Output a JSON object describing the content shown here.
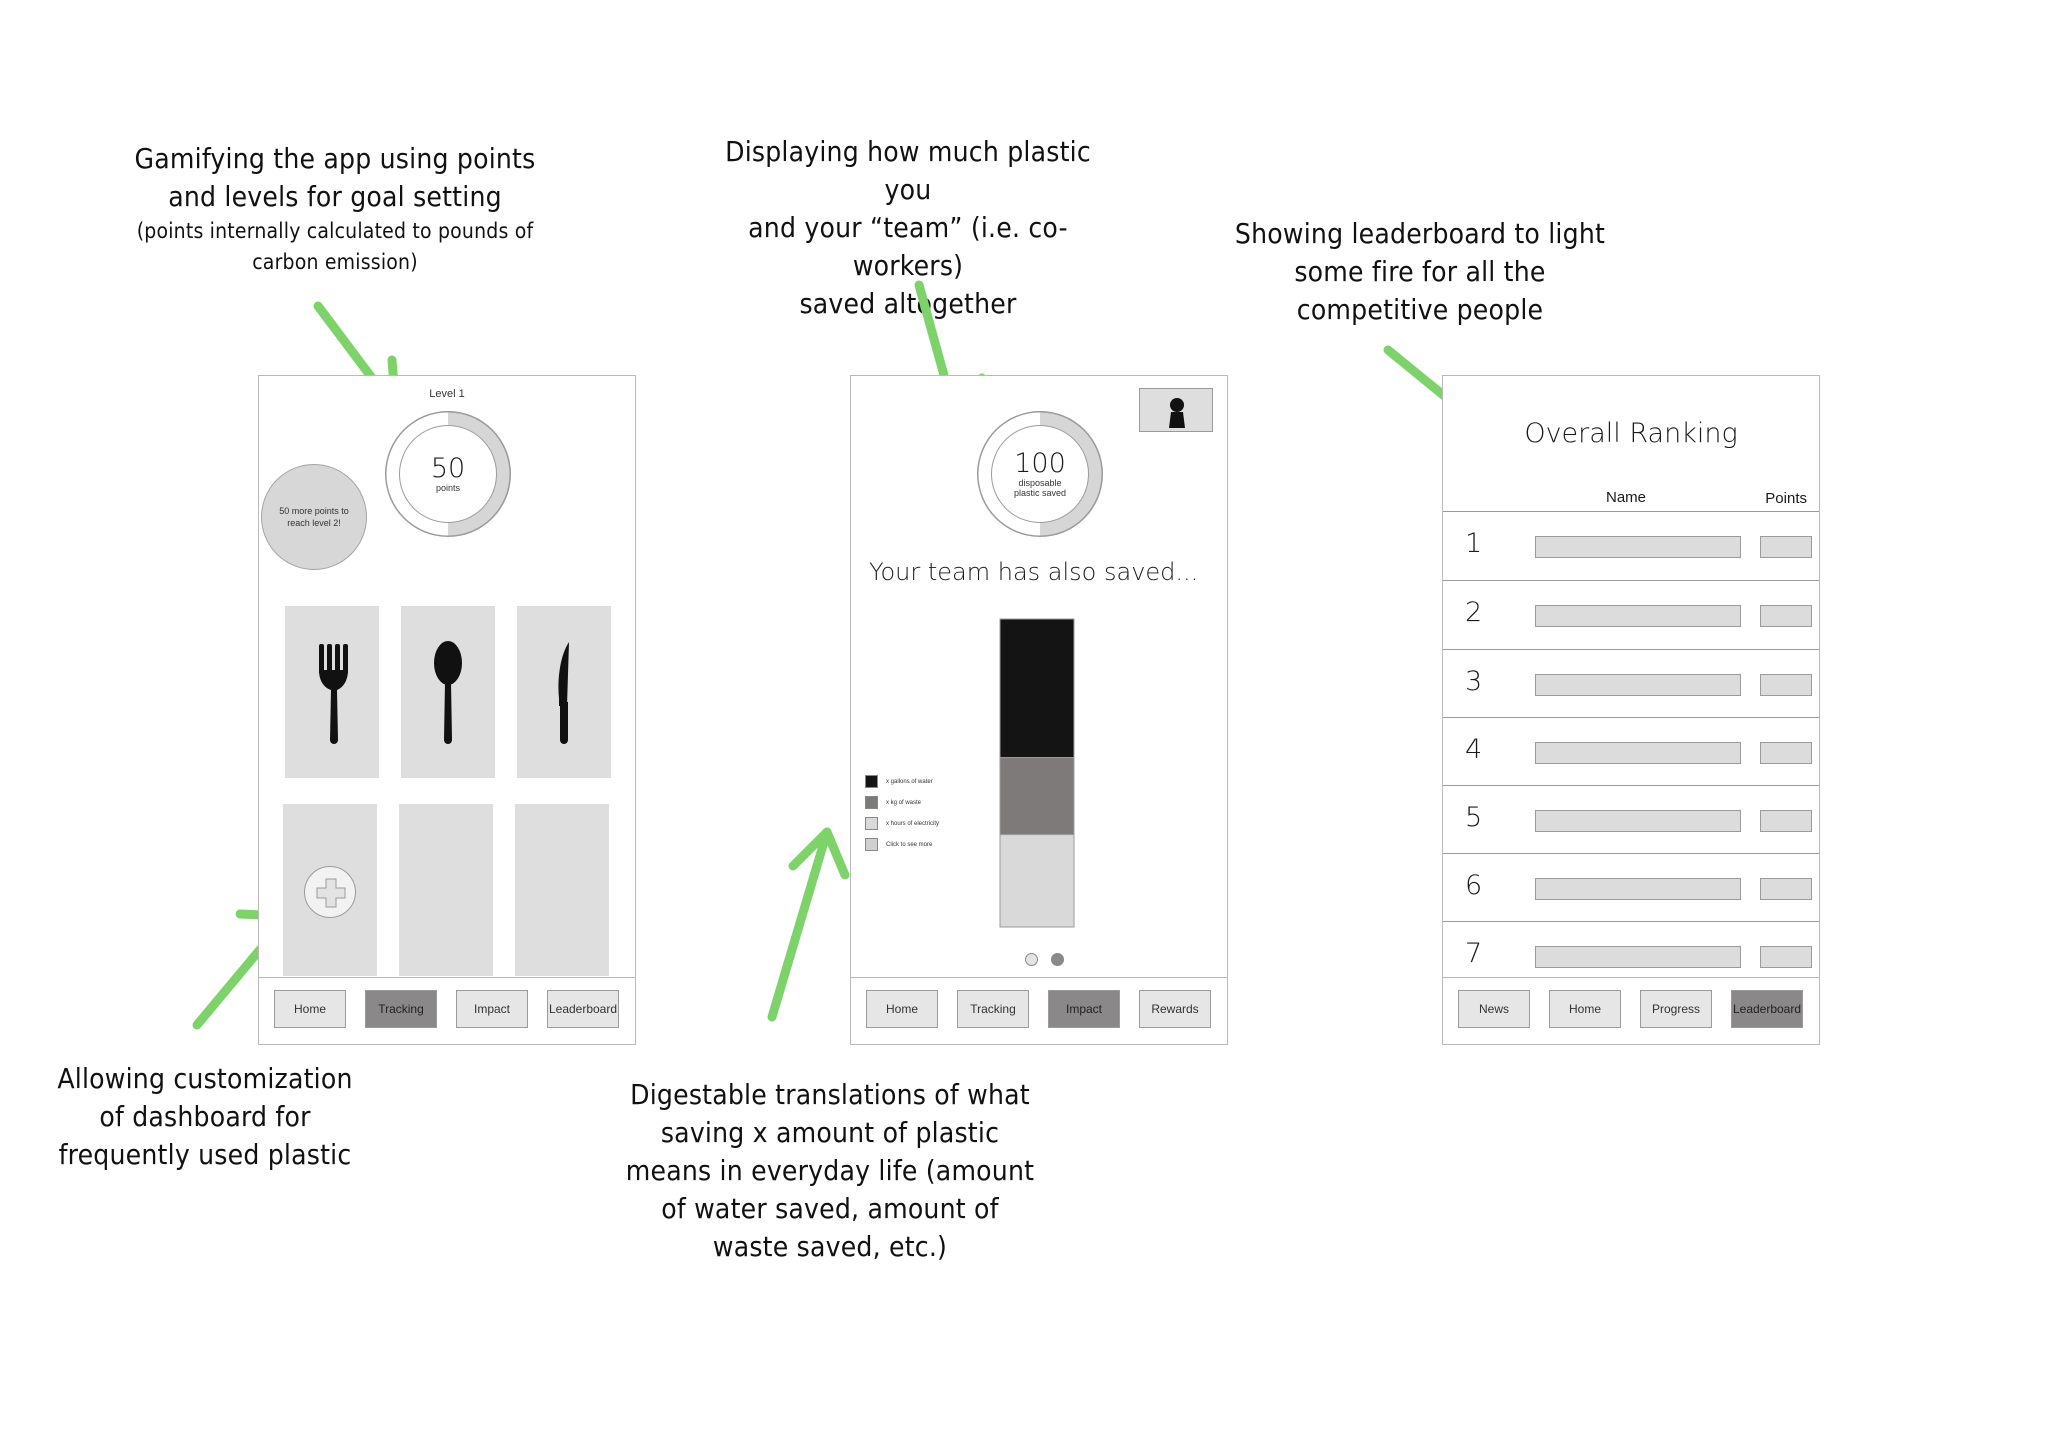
{
  "annotations": {
    "gamify": {
      "lines": [
        "Gamifying the app using points",
        "and levels for goal setting"
      ],
      "sub": [
        "(points internally calculated to pounds of",
        "carbon emission)"
      ]
    },
    "team": {
      "lines": [
        "Displaying how much plastic you",
        "and your “team” (i.e. co-workers)",
        "saved altogether"
      ]
    },
    "leaderboard": {
      "lines": [
        "Showing leaderboard to light",
        "some fire for all the",
        "competitive people"
      ]
    },
    "customize": {
      "lines": [
        "Allowing customization",
        "of dashboard for",
        "frequently used plastic"
      ]
    },
    "translations": {
      "lines": [
        "Digestable translations of what",
        "saving x amount of plastic",
        "means in everyday life (amount",
        "of water saved, amount of",
        "waste saved, etc.)"
      ]
    }
  },
  "colors": {
    "arrow": "#7dd36a",
    "active_tab": "#8a8888",
    "tile": "#dedede"
  },
  "tracking_screen": {
    "level_label": "Level 1",
    "points_value": "50",
    "points_unit": "points",
    "progress_fraction": 0.5,
    "hint": "50 more points to reach level 2!",
    "tiles": [
      {
        "icon": "fork-icon"
      },
      {
        "icon": "spoon-icon"
      },
      {
        "icon": "knife-icon"
      },
      {
        "icon": "add-icon"
      },
      {
        "icon": ""
      },
      {
        "icon": ""
      }
    ],
    "nav": [
      {
        "label": "Home",
        "active": false
      },
      {
        "label": "Tracking",
        "active": true
      },
      {
        "label": "Impact",
        "active": false
      },
      {
        "label": "Leaderboard",
        "active": false
      }
    ]
  },
  "impact_screen": {
    "saved_value": "100",
    "saved_unit": "disposable plastic saved",
    "progress_fraction": 0.5,
    "team_text": "Your team has also saved...",
    "legend": [
      {
        "label": "x gallons of water",
        "color": "#141414"
      },
      {
        "label": "x kg of waste",
        "color": "#7f7a7a"
      },
      {
        "label": "x hours of electricity",
        "color": "#d9d9d9"
      },
      {
        "label": "Click to see more",
        "color": "#cfcfcf"
      }
    ],
    "stack_segments": [
      {
        "name": "water",
        "share": 0.45,
        "color": "#141414"
      },
      {
        "name": "waste",
        "share": 0.25,
        "color": "#7f7a7a"
      },
      {
        "name": "electricity",
        "share": 0.3,
        "color": "#d9d9d9"
      }
    ],
    "page_dots": {
      "count": 2,
      "active_index": 1
    },
    "nav": [
      {
        "label": "Home",
        "active": false
      },
      {
        "label": "Tracking",
        "active": false
      },
      {
        "label": "Impact",
        "active": true
      },
      {
        "label": "Rewards",
        "active": false
      }
    ]
  },
  "leaderboard_screen": {
    "title": "Overall Ranking",
    "col_name": "Name",
    "col_points": "Points",
    "ranks": [
      "1",
      "2",
      "3",
      "4",
      "5",
      "6",
      "7"
    ],
    "nav": [
      {
        "label": "News",
        "active": false
      },
      {
        "label": "Home",
        "active": false
      },
      {
        "label": "Progress",
        "active": false
      },
      {
        "label": "Leaderboard",
        "active": true
      }
    ]
  }
}
